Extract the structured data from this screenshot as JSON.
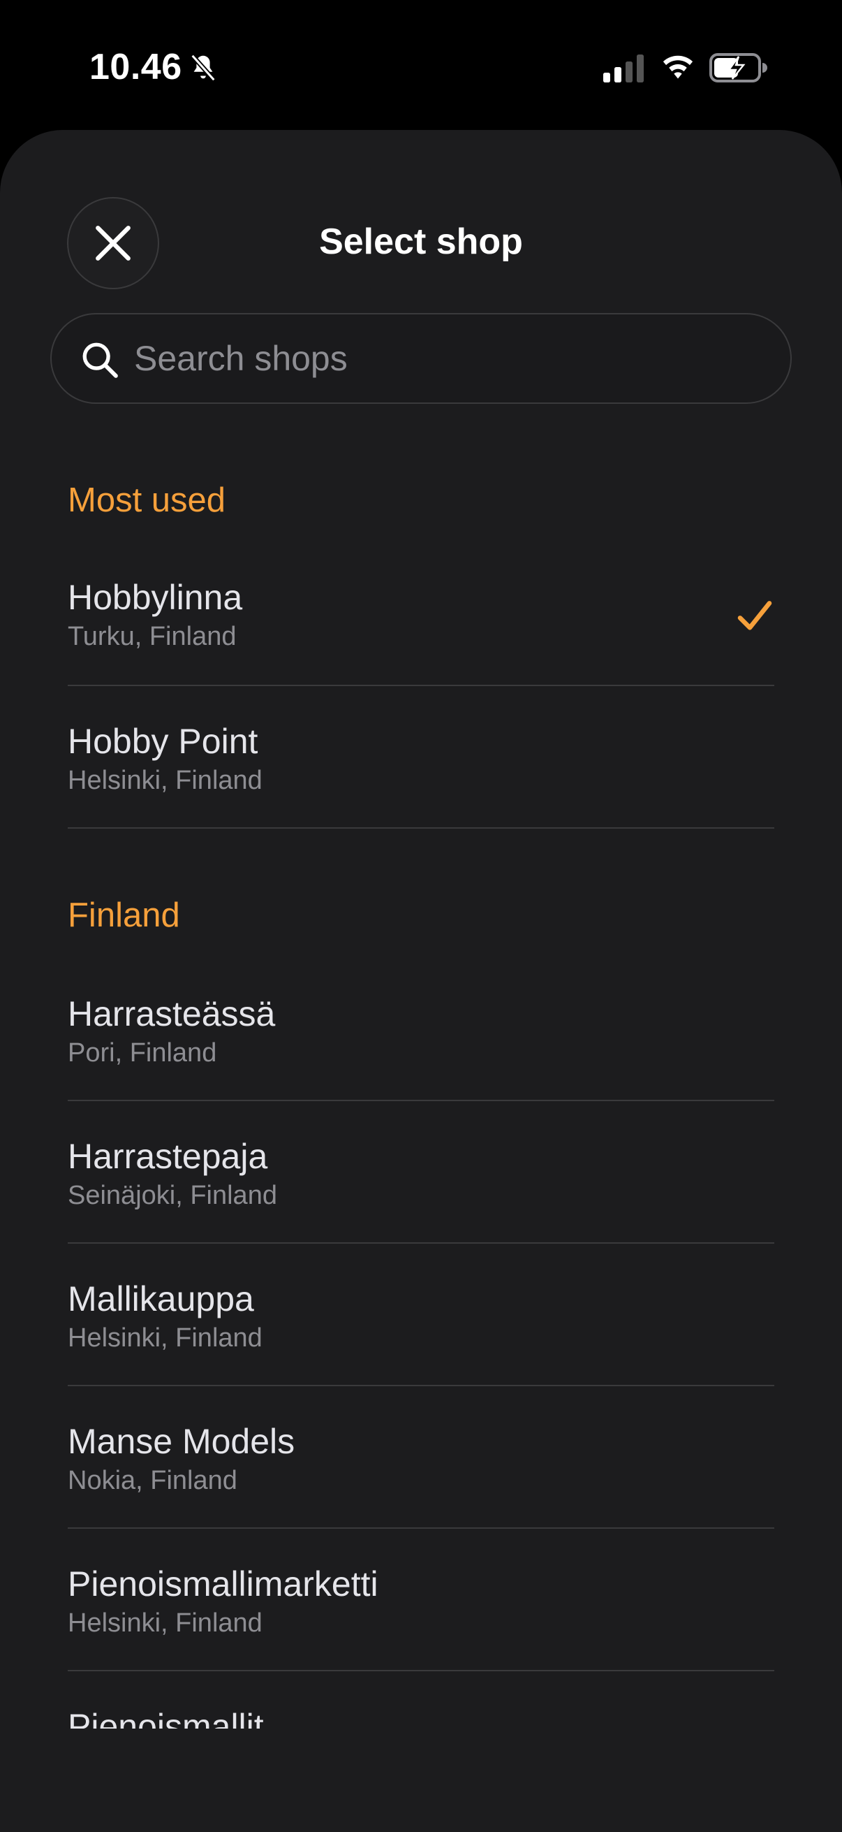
{
  "status_bar": {
    "time": "10.46"
  },
  "header": {
    "title": "Select shop"
  },
  "search": {
    "placeholder": "Search shops"
  },
  "sections": [
    {
      "title": "Most used",
      "items": [
        {
          "name": "Hobbylinna",
          "location": "Turku, Finland",
          "selected": true
        },
        {
          "name": "Hobby Point",
          "location": "Helsinki, Finland",
          "selected": false
        }
      ]
    },
    {
      "title": "Finland",
      "items": [
        {
          "name": "Harrasteässä",
          "location": "Pori, Finland",
          "selected": false
        },
        {
          "name": "Harrastepaja",
          "location": "Seinäjoki, Finland",
          "selected": false
        },
        {
          "name": "Mallikauppa",
          "location": "Helsinki, Finland",
          "selected": false
        },
        {
          "name": "Manse Models",
          "location": "Nokia, Finland",
          "selected": false
        },
        {
          "name": "Pienoismallimarketti",
          "location": "Helsinki, Finland",
          "selected": false
        },
        {
          "name": "Pienoismallit",
          "location": "",
          "selected": false
        }
      ]
    }
  ],
  "colors": {
    "accent": "#f6a03b",
    "sheet_background": "#1c1c1e",
    "secondary_text": "#8e8e93",
    "divider": "#3a3a3c"
  }
}
